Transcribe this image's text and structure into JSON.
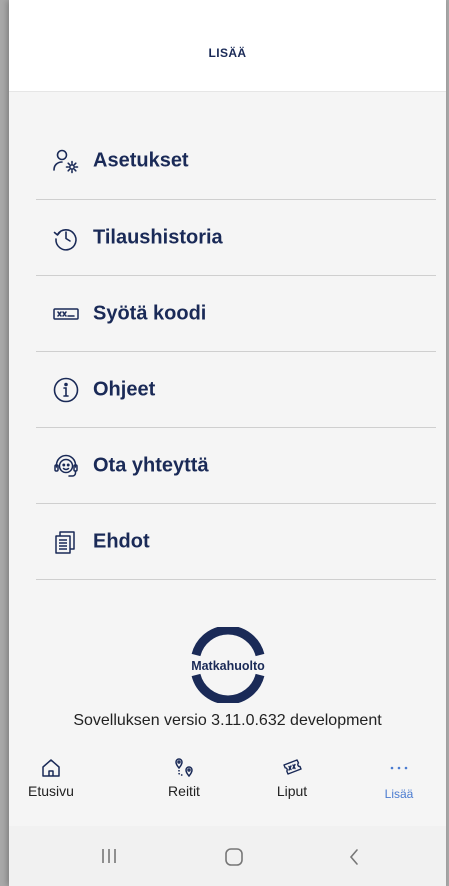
{
  "header": {
    "title": "LISÄÄ"
  },
  "menu": {
    "items": [
      {
        "label": "Asetukset",
        "icon": "user-settings-icon"
      },
      {
        "label": "Tilaushistoria",
        "icon": "history-icon"
      },
      {
        "label": "Syötä koodi",
        "icon": "code-input-icon"
      },
      {
        "label": "Ohjeet",
        "icon": "info-icon"
      },
      {
        "label": "Ota yhteyttä",
        "icon": "headset-icon"
      },
      {
        "label": "Ehdot",
        "icon": "documents-icon"
      }
    ]
  },
  "logo": {
    "text": "Matkahuolto"
  },
  "footer": {
    "version": "Sovelluksen versio 3.11.0.632  development"
  },
  "tabbar": {
    "items": [
      {
        "label": "Etusivu",
        "icon": "home-icon"
      },
      {
        "label": "Reitit",
        "icon": "route-icon"
      },
      {
        "label": "Liput",
        "icon": "ticket-icon"
      },
      {
        "label": "Lisää",
        "icon": "more-icon",
        "active": true
      }
    ]
  },
  "colors": {
    "primary": "#1a2a57",
    "active_tab": "#4a7bd0",
    "background": "#f5f5f5"
  }
}
